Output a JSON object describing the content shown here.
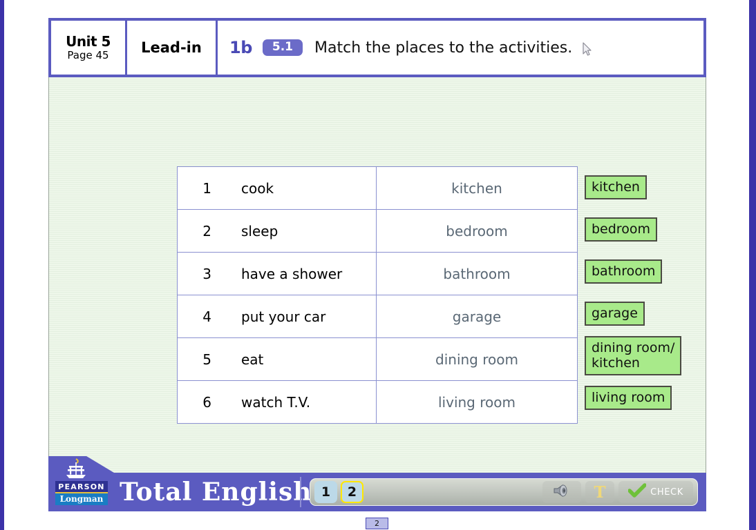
{
  "header": {
    "unit": "Unit 5",
    "page": "Page 45",
    "section": "Lead-in",
    "exercise_number": "1b",
    "audio_badge": "5.1",
    "instruction": "Match the places to the activities.",
    "cursor_icon": "mouse-pointer-icon"
  },
  "exercise": {
    "rows": [
      {
        "num": "1",
        "activity": "cook",
        "answer": "kitchen"
      },
      {
        "num": "2",
        "activity": "sleep",
        "answer": "bedroom"
      },
      {
        "num": "3",
        "activity": "have a shower",
        "answer": "bathroom"
      },
      {
        "num": "4",
        "activity": "put your car",
        "answer": "garage"
      },
      {
        "num": "5",
        "activity": "eat",
        "answer": "dining room"
      },
      {
        "num": "6",
        "activity": "watch T.V.",
        "answer": "living room"
      }
    ],
    "chips": [
      "kitchen",
      "bedroom",
      "bathroom",
      "garage",
      "dining room/\nkitchen",
      "living room"
    ]
  },
  "footer": {
    "brand_publisher": "PEARSON",
    "brand_imprint": "Longman",
    "brand_title": "Total English",
    "ship_icon": "sailing-ship-icon",
    "pages": [
      {
        "label": "1",
        "selected": false
      },
      {
        "label": "2",
        "selected": true
      }
    ],
    "tools": {
      "audio_icon": "speaker-icon",
      "text_tool_label": "T",
      "check_icon": "green-checkmark-icon",
      "check_label": "CHECK"
    }
  },
  "status": {
    "page_badge": "2"
  },
  "colors": {
    "frame_blue": "#5b5bc0",
    "edge_strip": "#3c32a8",
    "content_bg": "#eef7ea",
    "chip_green": "#a8ea8a",
    "answer_text": "#5a6875",
    "badge_purple": "#6b6bc8",
    "selected_ring": "#ffe800"
  }
}
